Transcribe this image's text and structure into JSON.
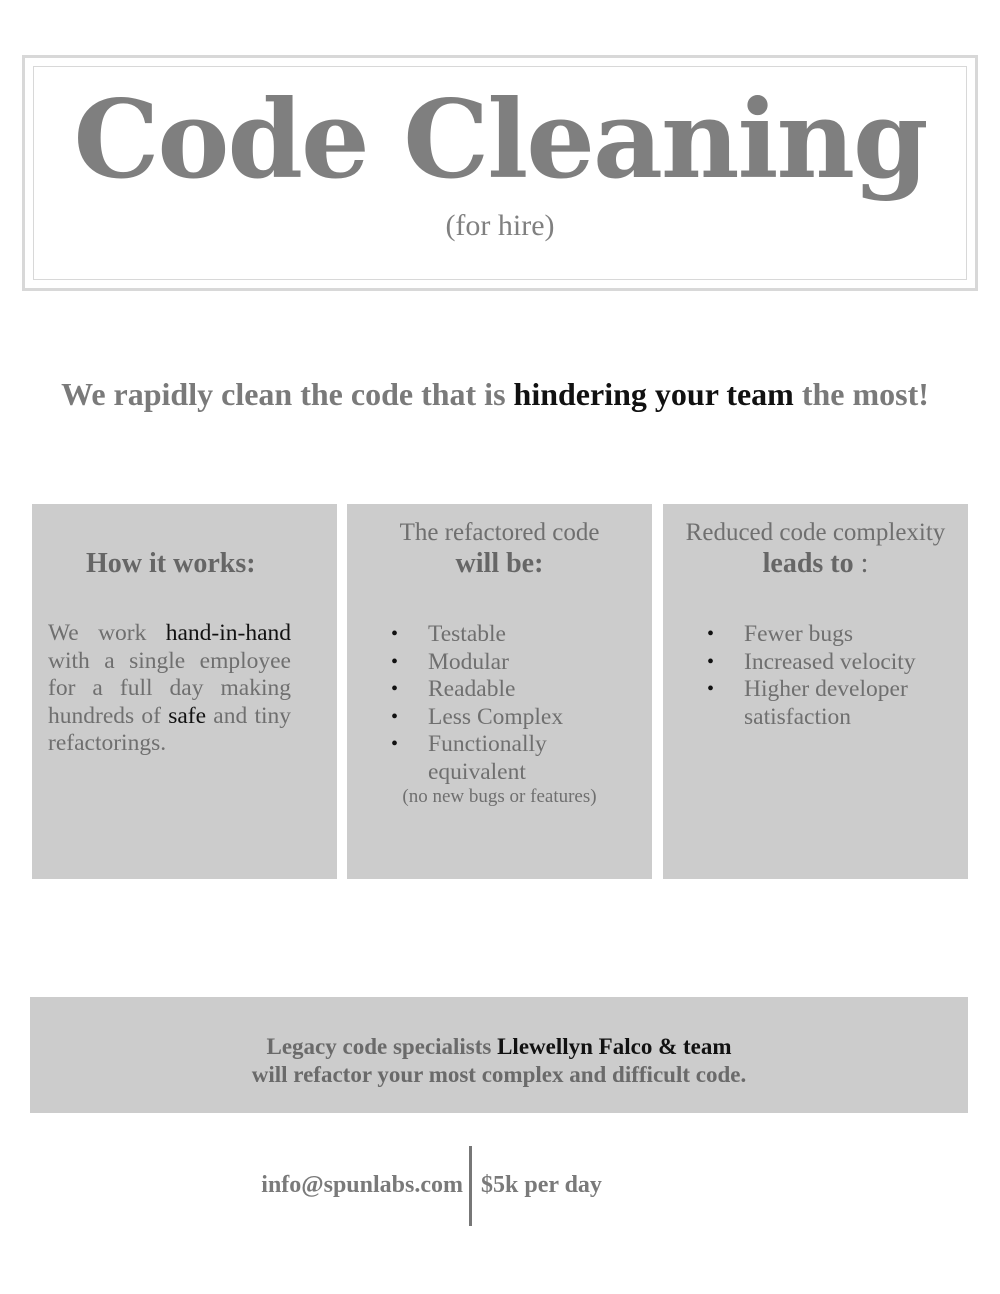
{
  "header": {
    "title": "Code Cleaning",
    "subtitle": "(for hire)"
  },
  "tagline": {
    "part1": "We rapidly clean the code that is ",
    "emphasis": "hindering your team",
    "part2": " the most!"
  },
  "columns": {
    "how": {
      "heading": "How it works:",
      "body_1": "We work ",
      "body_em1": "hand-in-hand",
      "body_2": " with a single employee for a full day making hundreds of ",
      "body_em2": "safe",
      "body_3": " and tiny refactorings."
    },
    "refactored": {
      "pre": "The refactored code",
      "heading": "will be:",
      "items": [
        "Testable",
        "Modular",
        "Readable",
        "Less Complex",
        "Functionally equivalent"
      ],
      "note": "(no new bugs or features)"
    },
    "reduced": {
      "pre": "Reduced code complexity",
      "heading": "leads to",
      "heading_suffix": " :",
      "items": [
        "Fewer bugs",
        "Increased velocity",
        "Higher developer satisfaction"
      ]
    }
  },
  "banner": {
    "line1_a": "Legacy code specialists ",
    "line1_b": "Llewellyn Falco & team",
    "line2": "will refactor your most complex and difficult code."
  },
  "contact": {
    "email": "info@spunlabs.com",
    "price": "$5k per day"
  }
}
